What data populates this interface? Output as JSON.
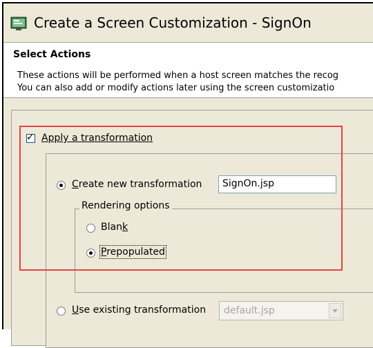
{
  "window": {
    "title": "Create a Screen Customization - SignOn",
    "icon": "screen-customization-icon"
  },
  "banner": {
    "heading": "Select Actions",
    "line1": "These actions will be performed when a host screen matches the recog",
    "line2": "You can also add or modify actions later using the screen customizatio"
  },
  "apply_transformation": {
    "label": "Apply a transformation",
    "checked": true
  },
  "create_new": {
    "label_prefix": "",
    "label_accel": "C",
    "label_rest": "reate new transformation",
    "selected": true,
    "value": "SignOn.jsp"
  },
  "rendering_options": {
    "title": "Rendering options",
    "blank": {
      "label_pre": "Blan",
      "label_accel": "k",
      "selected": false
    },
    "prepopulated": {
      "label_accel": "P",
      "label_rest": "repopulated",
      "selected": true
    }
  },
  "use_existing": {
    "label_accel": "U",
    "label_rest": "se existing transformation",
    "selected": false,
    "value": "default.jsp"
  },
  "colors": {
    "highlight": "#e8413f",
    "dialog_bg": "#ece9d8"
  }
}
